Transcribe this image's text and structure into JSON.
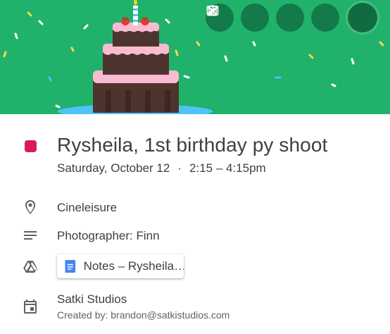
{
  "event": {
    "title": "Rysheila, 1st birthday py shoot",
    "date": "Saturday, October 12",
    "separator": "·",
    "time": "2:15 – 4:15pm",
    "color": "#d81b60"
  },
  "details": {
    "location": "Cineleisure",
    "description": "Photographer: Finn",
    "attachment": "Notes – Rysheila…",
    "calendar": "Satki Studios",
    "created_by": "Created by: brandon@satkistudios.com"
  },
  "toolbar": {
    "icons": [
      "edit-icon",
      "delete-icon",
      "email-icon",
      "more-options-icon",
      "close-icon"
    ]
  },
  "banner": {
    "background": "#20b26b",
    "theme": "birthday-cake"
  }
}
